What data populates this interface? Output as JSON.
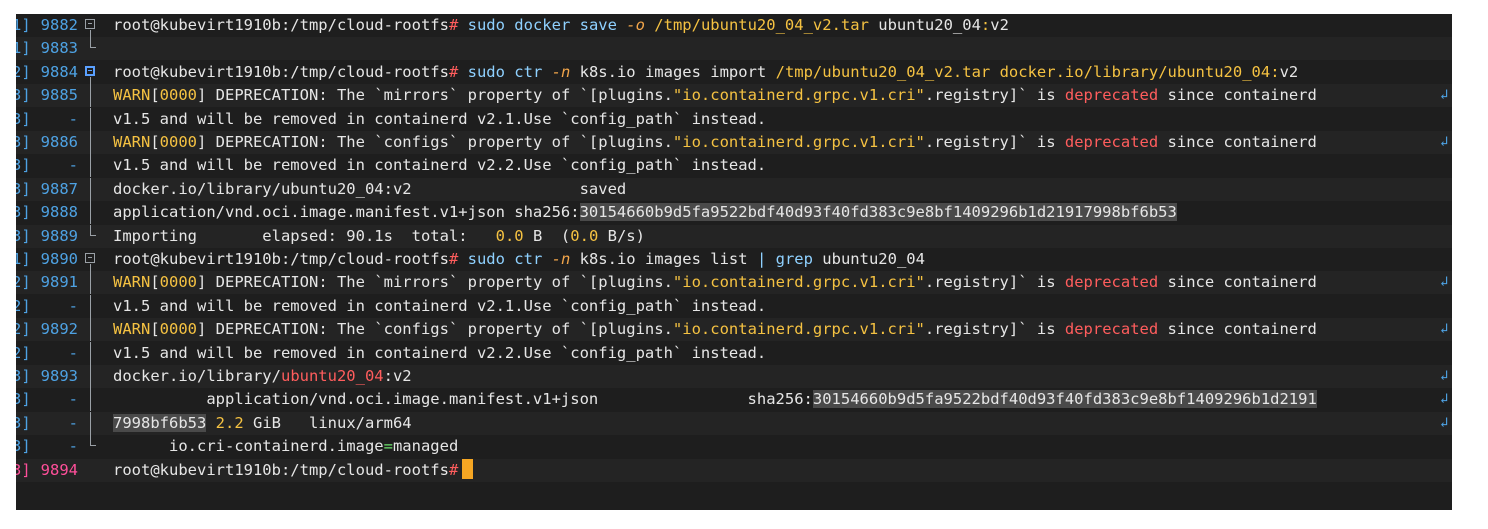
{
  "terminal": {
    "lines": [
      {
        "num": "9882",
        "prefix": "1]",
        "fold": "box",
        "segments": [
          {
            "t": "root@kubevirt1910b:/tmp/cloud-rootfs",
            "c": "c-prompt"
          },
          {
            "t": "#",
            "c": "c-red"
          },
          {
            "t": " sudo docker save ",
            "c": "c-cmd"
          },
          {
            "t": "-o",
            "c": "c-flag"
          },
          {
            "t": " /tmp/ubuntu20_04_v2.tar",
            "c": "c-path"
          },
          {
            "t": " ubuntu20_04",
            "c": "c-prompt"
          },
          {
            "t": ":",
            "c": "c-path"
          },
          {
            "t": "v2",
            "c": "c-prompt"
          }
        ]
      },
      {
        "num": "9883",
        "prefix": "1]",
        "fold": "end",
        "segments": []
      },
      {
        "num": "9884",
        "prefix": "2]",
        "fold": "box-active",
        "segments": [
          {
            "t": "root@kubevirt1910b:/tmp/cloud-rootfs",
            "c": "c-prompt"
          },
          {
            "t": "#",
            "c": "c-red"
          },
          {
            "t": " sudo ctr ",
            "c": "c-cmd"
          },
          {
            "t": "-n",
            "c": "c-flag"
          },
          {
            "t": " k8s.io images import ",
            "c": "c-prompt"
          },
          {
            "t": "/tmp/ubuntu20_04_v2.tar",
            "c": "c-path"
          },
          {
            "t": " docker.io/library/ubuntu20_04",
            "c": "c-path"
          },
          {
            "t": ":",
            "c": "c-path"
          },
          {
            "t": "v2",
            "c": "c-prompt"
          }
        ]
      },
      {
        "num": "9885",
        "prefix": "3]",
        "fold": "bar",
        "wrap": "↲",
        "segments": [
          {
            "t": "WARN",
            "c": "c-warn"
          },
          {
            "t": "[",
            "c": "c-prompt"
          },
          {
            "t": "0000",
            "c": "c-num"
          },
          {
            "t": "] DEPRECATION: The `mirrors` property of `[plugins.",
            "c": "c-prompt"
          },
          {
            "t": "\"io.containerd.grpc.v1.cri\"",
            "c": "c-str"
          },
          {
            "t": ".registry]` is ",
            "c": "c-prompt"
          },
          {
            "t": "deprecated",
            "c": "c-red"
          },
          {
            "t": " since containerd",
            "c": "c-prompt"
          }
        ]
      },
      {
        "num": "-",
        "prefix": "3]",
        "fold": "bar",
        "segments": [
          {
            "t": "v1.5 and will be removed in containerd v2.1.Use `config_path` instead.",
            "c": "c-prompt"
          }
        ]
      },
      {
        "num": "9886",
        "prefix": "3]",
        "fold": "bar",
        "wrap": "↲",
        "segments": [
          {
            "t": "WARN",
            "c": "c-warn"
          },
          {
            "t": "[",
            "c": "c-prompt"
          },
          {
            "t": "0000",
            "c": "c-num"
          },
          {
            "t": "] DEPRECATION: The `configs` property of `[plugins.",
            "c": "c-prompt"
          },
          {
            "t": "\"io.containerd.grpc.v1.cri\"",
            "c": "c-str"
          },
          {
            "t": ".registry]` is ",
            "c": "c-prompt"
          },
          {
            "t": "deprecated",
            "c": "c-red"
          },
          {
            "t": " since containerd",
            "c": "c-prompt"
          }
        ]
      },
      {
        "num": "-",
        "prefix": "3]",
        "fold": "bar",
        "segments": [
          {
            "t": "v1.5 and will be removed in containerd v2.2.Use `config_path` instead.",
            "c": "c-prompt"
          }
        ]
      },
      {
        "num": "9887",
        "prefix": "3]",
        "fold": "bar",
        "segments": [
          {
            "t": "docker.io/library/ubuntu20_04:v2                  saved",
            "c": "c-prompt"
          }
        ]
      },
      {
        "num": "9888",
        "prefix": "3]",
        "fold": "bar",
        "segments": [
          {
            "t": "application/vnd.oci.image.manifest.v1+json sha256:",
            "c": "c-prompt"
          },
          {
            "t": "30154660b9d5fa9522bdf40d93f40fd383c9e8bf1409296b1d21917998bf6b53",
            "c": "c-hl"
          }
        ]
      },
      {
        "num": "9889",
        "prefix": "3]",
        "fold": "end",
        "segments": [
          {
            "t": "Importing       elapsed: 90.1s  total:   ",
            "c": "c-prompt"
          },
          {
            "t": "0.0",
            "c": "c-num"
          },
          {
            "t": " B  (",
            "c": "c-prompt"
          },
          {
            "t": "0.0",
            "c": "c-num"
          },
          {
            "t": " B/s)",
            "c": "c-prompt"
          }
        ]
      },
      {
        "num": "9890",
        "prefix": "1]",
        "fold": "box",
        "segments": [
          {
            "t": "root@kubevirt1910b:/tmp/cloud-rootfs",
            "c": "c-prompt"
          },
          {
            "t": "#",
            "c": "c-red"
          },
          {
            "t": " sudo ctr ",
            "c": "c-cmd"
          },
          {
            "t": "-n",
            "c": "c-flag"
          },
          {
            "t": " k8s.io images list ",
            "c": "c-prompt"
          },
          {
            "t": "|",
            "c": "c-blue"
          },
          {
            "t": " grep",
            "c": "c-cmd"
          },
          {
            "t": " ubuntu20_04",
            "c": "c-prompt"
          }
        ]
      },
      {
        "num": "9891",
        "prefix": "2]",
        "fold": "bar",
        "wrap": "↲",
        "segments": [
          {
            "t": "WARN",
            "c": "c-warn"
          },
          {
            "t": "[",
            "c": "c-prompt"
          },
          {
            "t": "0000",
            "c": "c-num"
          },
          {
            "t": "] DEPRECATION: The `mirrors` property of `[plugins.",
            "c": "c-prompt"
          },
          {
            "t": "\"io.containerd.grpc.v1.cri\"",
            "c": "c-str"
          },
          {
            "t": ".registry]` is ",
            "c": "c-prompt"
          },
          {
            "t": "deprecated",
            "c": "c-red"
          },
          {
            "t": " since containerd",
            "c": "c-prompt"
          }
        ]
      },
      {
        "num": "-",
        "prefix": "2]",
        "fold": "bar",
        "segments": [
          {
            "t": "v1.5 and will be removed in containerd v2.1.Use `config_path` instead.",
            "c": "c-prompt"
          }
        ]
      },
      {
        "num": "9892",
        "prefix": "2]",
        "fold": "bar",
        "wrap": "↲",
        "segments": [
          {
            "t": "WARN",
            "c": "c-warn"
          },
          {
            "t": "[",
            "c": "c-prompt"
          },
          {
            "t": "0000",
            "c": "c-num"
          },
          {
            "t": "] DEPRECATION: The `configs` property of `[plugins.",
            "c": "c-prompt"
          },
          {
            "t": "\"io.containerd.grpc.v1.cri\"",
            "c": "c-str"
          },
          {
            "t": ".registry]` is ",
            "c": "c-prompt"
          },
          {
            "t": "deprecated",
            "c": "c-red"
          },
          {
            "t": " since containerd",
            "c": "c-prompt"
          }
        ]
      },
      {
        "num": "-",
        "prefix": "2]",
        "fold": "bar",
        "segments": [
          {
            "t": "v1.5 and will be removed in containerd v2.2.Use `config_path` instead.",
            "c": "c-prompt"
          }
        ]
      },
      {
        "num": "9893",
        "prefix": "3]",
        "fold": "bar",
        "wrap": "↲",
        "segments": [
          {
            "t": "docker.io/library/",
            "c": "c-prompt"
          },
          {
            "t": "ubuntu20_04",
            "c": "c-red"
          },
          {
            "t": ":v2",
            "c": "c-prompt"
          }
        ]
      },
      {
        "num": "-",
        "prefix": "3]",
        "fold": "bar",
        "wrap": "↲",
        "segments": [
          {
            "t": "          application/vnd.oci.image.manifest.v1+json                sha256:",
            "c": "c-prompt"
          },
          {
            "t": "30154660b9d5fa9522bdf40d93f40fd383c9e8bf1409296b1d2191",
            "c": "c-hl"
          }
        ]
      },
      {
        "num": "-",
        "prefix": "3]",
        "fold": "bar",
        "wrap": "↲",
        "segments": [
          {
            "t": "7998bf6b53",
            "c": "c-hl"
          },
          {
            "t": " ",
            "c": "c-prompt"
          },
          {
            "t": "2.2",
            "c": "c-num"
          },
          {
            "t": " GiB   linux/arm64",
            "c": "c-prompt"
          }
        ]
      },
      {
        "num": "-",
        "prefix": "3]",
        "fold": "end",
        "segments": [
          {
            "t": "      io.cri-containerd.image",
            "c": "c-prompt"
          },
          {
            "t": "=",
            "c": "c-green"
          },
          {
            "t": "managed",
            "c": "c-prompt"
          }
        ]
      },
      {
        "num": "9894",
        "prefix": "3]",
        "fold": "none",
        "numColor": "#ff4f9a",
        "cursor": true,
        "segments": [
          {
            "t": "root@kubevirt1910b:/tmp/cloud-rootfs",
            "c": "c-prompt"
          },
          {
            "t": "#",
            "c": "c-red"
          }
        ]
      }
    ]
  }
}
